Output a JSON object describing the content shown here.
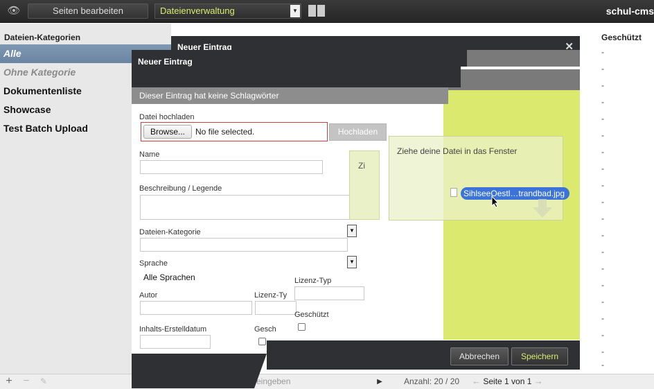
{
  "topbar": {
    "edit_pages_label": "Seiten bearbeiten",
    "module_select_value": "Dateienverwaltung",
    "site_name": "schul-cms"
  },
  "sidebar": {
    "title": "Dateien-Kategorien",
    "items": [
      {
        "label": "Alle"
      },
      {
        "label": "Ohne Kategorie"
      },
      {
        "label": "Dokumentenliste"
      },
      {
        "label": "Showcase"
      },
      {
        "label": "Test Batch Upload"
      }
    ]
  },
  "table": {
    "protected_header": "Geschützt",
    "rows": [
      "-",
      "-",
      "-",
      "-",
      "-",
      "-",
      "-",
      "-",
      "-",
      "-",
      "-",
      "-",
      "-",
      "-",
      "-",
      "-",
      "-",
      "-",
      "-",
      "-"
    ]
  },
  "back_dialog": {
    "title": "Neuer Eintrag"
  },
  "dialog": {
    "title": "Neuer Eintrag",
    "no_tags_text": "Dieser Eintrag hat keine Schlagwörter",
    "upload_label": "Datei hochladen",
    "browse_label": "Browse...",
    "file_status": "No file selected.",
    "upload_button": "Hochladen",
    "name_label": "Name",
    "description_label": "Beschreibung / Legende",
    "category_label": "Dateien-Kategorie",
    "language_label": "Sprache",
    "language_value": "Alle Sprachen",
    "author_label": "Autor",
    "license_type_label_partial": "Lizenz-Ty",
    "license_type_label": "Lizenz-Typ",
    "created_label": "Inhalts-Erstelldatum",
    "protected_label_partial": "Gesch",
    "protected_label": "Geschützt",
    "dropzone_partial": "Zi",
    "dropzone_text": "Ziehe deine Datei in das Fenster",
    "dragged_file": "SihlseeOestl…trandbad.jpg",
    "cancel_button": "Abbrechen",
    "save_button": "Speichern"
  },
  "bottombar": {
    "search_placeholder": "eingeben",
    "count_text": "Anzahl: 20 / 20",
    "pager_text": "Seite 1 von 1"
  },
  "colors": {
    "fold_yellow": "#dbe96f",
    "accent_text": "#d7ee6f",
    "selected_item": "#7088a6",
    "dialog_dark": "#2f3034"
  }
}
